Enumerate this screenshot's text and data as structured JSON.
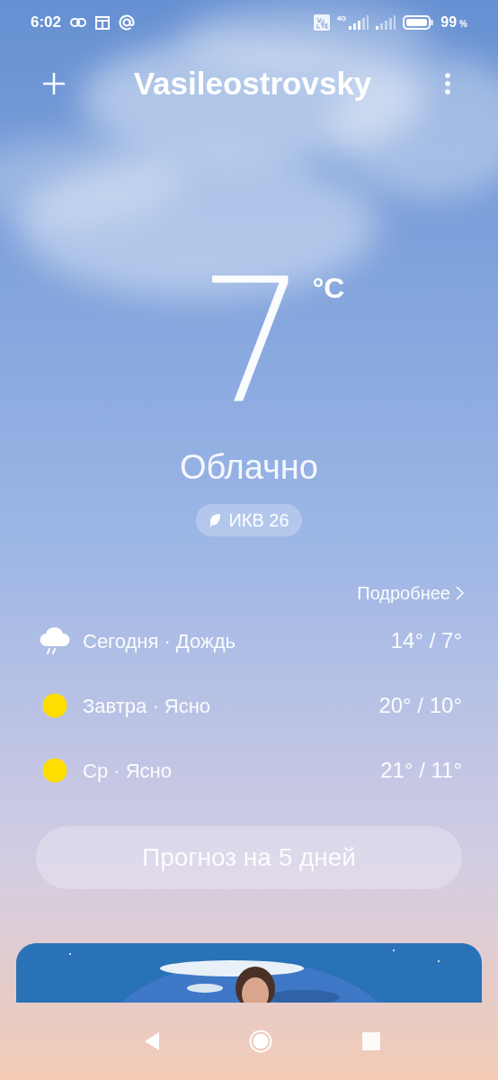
{
  "status_bar": {
    "time": "6:02",
    "network": "4G",
    "battery": "99",
    "battery_unit": "%"
  },
  "header": {
    "city": "Vasileostrovsky"
  },
  "current": {
    "temperature": "7",
    "unit": "°C",
    "condition": "Облачно",
    "aqi": "ИКВ 26"
  },
  "details_link": "Подробнее",
  "forecast": [
    {
      "kind": "rain",
      "label": "Сегодня · Дождь",
      "range": "14° / 7°"
    },
    {
      "kind": "sunny",
      "label": "Завтра · Ясно",
      "range": "20° / 10°"
    },
    {
      "kind": "sunny",
      "label": "Ср · Ясно",
      "range": "21° / 11°"
    }
  ],
  "forecast_button": "Прогноз на 5 дней"
}
